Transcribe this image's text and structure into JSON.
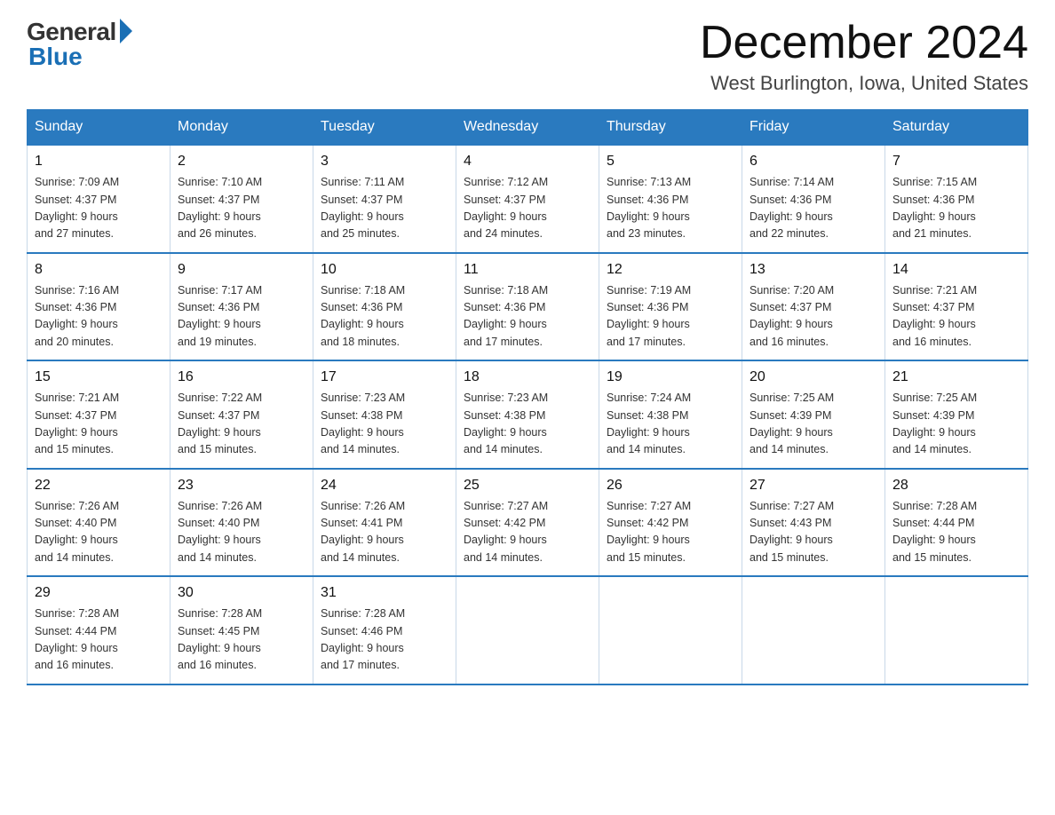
{
  "logo": {
    "general": "General",
    "blue": "Blue"
  },
  "title": "December 2024",
  "subtitle": "West Burlington, Iowa, United States",
  "days_of_week": [
    "Sunday",
    "Monday",
    "Tuesday",
    "Wednesday",
    "Thursday",
    "Friday",
    "Saturday"
  ],
  "weeks": [
    [
      {
        "day": "1",
        "sunrise": "7:09 AM",
        "sunset": "4:37 PM",
        "daylight": "9 hours and 27 minutes."
      },
      {
        "day": "2",
        "sunrise": "7:10 AM",
        "sunset": "4:37 PM",
        "daylight": "9 hours and 26 minutes."
      },
      {
        "day": "3",
        "sunrise": "7:11 AM",
        "sunset": "4:37 PM",
        "daylight": "9 hours and 25 minutes."
      },
      {
        "day": "4",
        "sunrise": "7:12 AM",
        "sunset": "4:37 PM",
        "daylight": "9 hours and 24 minutes."
      },
      {
        "day": "5",
        "sunrise": "7:13 AM",
        "sunset": "4:36 PM",
        "daylight": "9 hours and 23 minutes."
      },
      {
        "day": "6",
        "sunrise": "7:14 AM",
        "sunset": "4:36 PM",
        "daylight": "9 hours and 22 minutes."
      },
      {
        "day": "7",
        "sunrise": "7:15 AM",
        "sunset": "4:36 PM",
        "daylight": "9 hours and 21 minutes."
      }
    ],
    [
      {
        "day": "8",
        "sunrise": "7:16 AM",
        "sunset": "4:36 PM",
        "daylight": "9 hours and 20 minutes."
      },
      {
        "day": "9",
        "sunrise": "7:17 AM",
        "sunset": "4:36 PM",
        "daylight": "9 hours and 19 minutes."
      },
      {
        "day": "10",
        "sunrise": "7:18 AM",
        "sunset": "4:36 PM",
        "daylight": "9 hours and 18 minutes."
      },
      {
        "day": "11",
        "sunrise": "7:18 AM",
        "sunset": "4:36 PM",
        "daylight": "9 hours and 17 minutes."
      },
      {
        "day": "12",
        "sunrise": "7:19 AM",
        "sunset": "4:36 PM",
        "daylight": "9 hours and 17 minutes."
      },
      {
        "day": "13",
        "sunrise": "7:20 AM",
        "sunset": "4:37 PM",
        "daylight": "9 hours and 16 minutes."
      },
      {
        "day": "14",
        "sunrise": "7:21 AM",
        "sunset": "4:37 PM",
        "daylight": "9 hours and 16 minutes."
      }
    ],
    [
      {
        "day": "15",
        "sunrise": "7:21 AM",
        "sunset": "4:37 PM",
        "daylight": "9 hours and 15 minutes."
      },
      {
        "day": "16",
        "sunrise": "7:22 AM",
        "sunset": "4:37 PM",
        "daylight": "9 hours and 15 minutes."
      },
      {
        "day": "17",
        "sunrise": "7:23 AM",
        "sunset": "4:38 PM",
        "daylight": "9 hours and 14 minutes."
      },
      {
        "day": "18",
        "sunrise": "7:23 AM",
        "sunset": "4:38 PM",
        "daylight": "9 hours and 14 minutes."
      },
      {
        "day": "19",
        "sunrise": "7:24 AM",
        "sunset": "4:38 PM",
        "daylight": "9 hours and 14 minutes."
      },
      {
        "day": "20",
        "sunrise": "7:25 AM",
        "sunset": "4:39 PM",
        "daylight": "9 hours and 14 minutes."
      },
      {
        "day": "21",
        "sunrise": "7:25 AM",
        "sunset": "4:39 PM",
        "daylight": "9 hours and 14 minutes."
      }
    ],
    [
      {
        "day": "22",
        "sunrise": "7:26 AM",
        "sunset": "4:40 PM",
        "daylight": "9 hours and 14 minutes."
      },
      {
        "day": "23",
        "sunrise": "7:26 AM",
        "sunset": "4:40 PM",
        "daylight": "9 hours and 14 minutes."
      },
      {
        "day": "24",
        "sunrise": "7:26 AM",
        "sunset": "4:41 PM",
        "daylight": "9 hours and 14 minutes."
      },
      {
        "day": "25",
        "sunrise": "7:27 AM",
        "sunset": "4:42 PM",
        "daylight": "9 hours and 14 minutes."
      },
      {
        "day": "26",
        "sunrise": "7:27 AM",
        "sunset": "4:42 PM",
        "daylight": "9 hours and 15 minutes."
      },
      {
        "day": "27",
        "sunrise": "7:27 AM",
        "sunset": "4:43 PM",
        "daylight": "9 hours and 15 minutes."
      },
      {
        "day": "28",
        "sunrise": "7:28 AM",
        "sunset": "4:44 PM",
        "daylight": "9 hours and 15 minutes."
      }
    ],
    [
      {
        "day": "29",
        "sunrise": "7:28 AM",
        "sunset": "4:44 PM",
        "daylight": "9 hours and 16 minutes."
      },
      {
        "day": "30",
        "sunrise": "7:28 AM",
        "sunset": "4:45 PM",
        "daylight": "9 hours and 16 minutes."
      },
      {
        "day": "31",
        "sunrise": "7:28 AM",
        "sunset": "4:46 PM",
        "daylight": "9 hours and 17 minutes."
      },
      null,
      null,
      null,
      null
    ]
  ],
  "labels": {
    "sunrise": "Sunrise:",
    "sunset": "Sunset:",
    "daylight": "Daylight:"
  }
}
